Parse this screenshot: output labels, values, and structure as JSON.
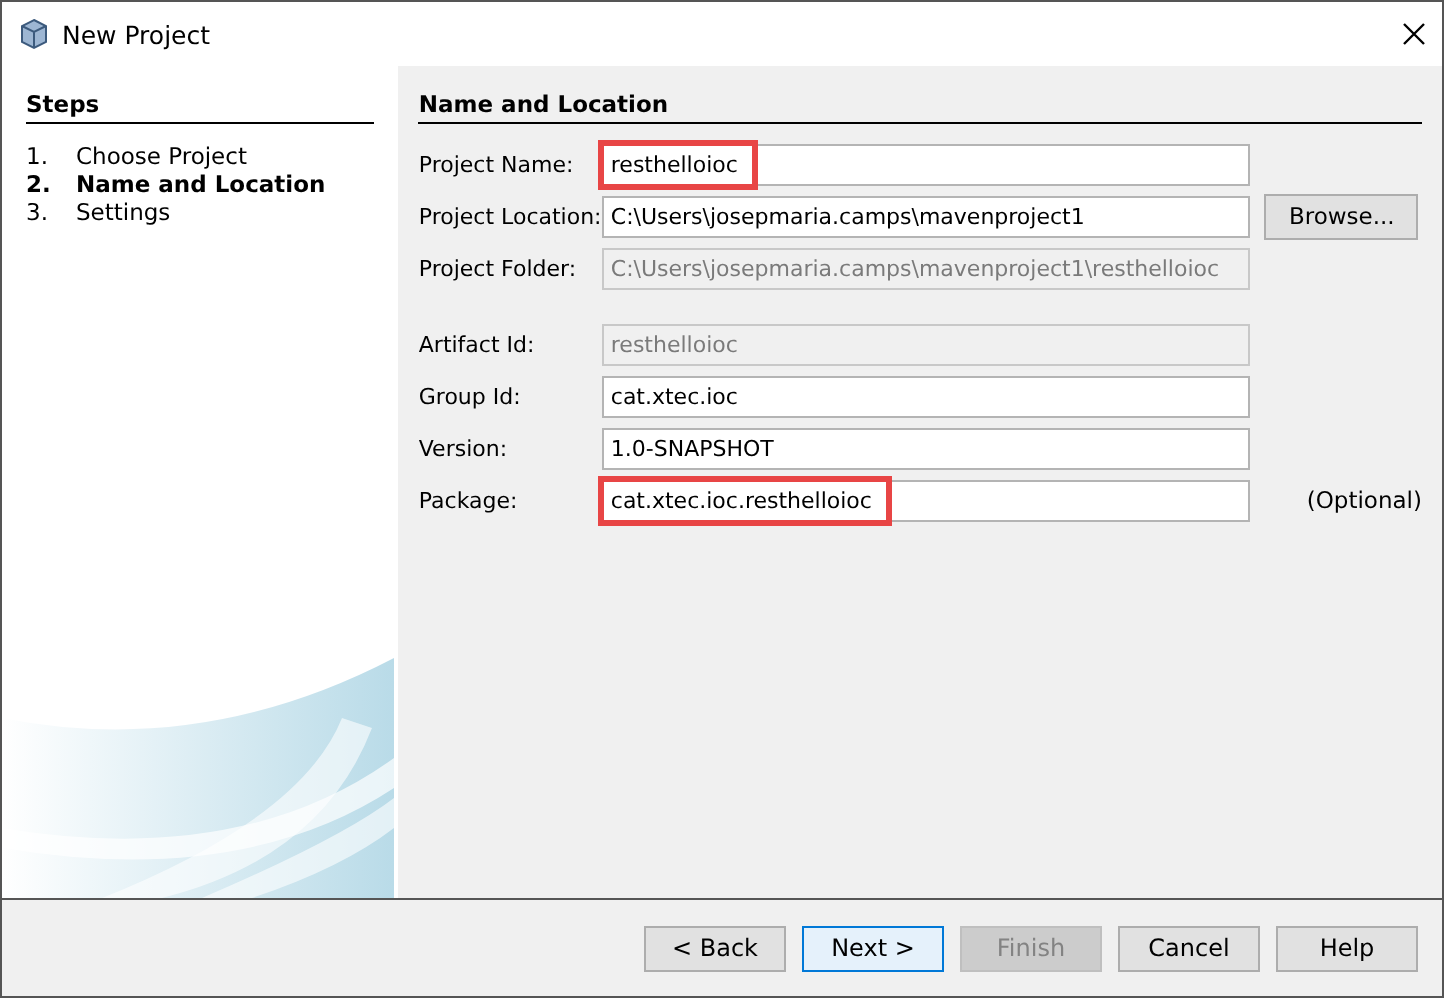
{
  "window": {
    "title": "New Project"
  },
  "steps": {
    "heading": "Steps",
    "items": [
      {
        "number": "1.",
        "label": "Choose Project",
        "selected": false
      },
      {
        "number": "2.",
        "label": "Name and Location",
        "selected": true
      },
      {
        "number": "3.",
        "label": "Settings",
        "selected": false
      }
    ]
  },
  "panel": {
    "heading": "Name and Location",
    "field_groups": [
      {
        "fields": [
          {
            "label": "Project Name:",
            "value": "resthelloioc",
            "disabled": false,
            "highlighted": true
          },
          {
            "label": "Project Location:",
            "value": "C:\\Users\\josepmaria.camps\\mavenproject1",
            "disabled": false,
            "highlighted": false,
            "button": "Browse..."
          },
          {
            "label": "Project Folder:",
            "value": "C:\\Users\\josepmaria.camps\\mavenproject1\\resthelloioc",
            "disabled": true,
            "highlighted": false
          }
        ]
      },
      {
        "fields": [
          {
            "label": "Artifact Id:",
            "value": "resthelloioc",
            "disabled": true,
            "highlighted": false
          },
          {
            "label": "Group Id:",
            "value": "cat.xtec.ioc",
            "disabled": false,
            "highlighted": false
          },
          {
            "label": "Version:",
            "value": "1.0-SNAPSHOT",
            "disabled": false,
            "highlighted": false
          },
          {
            "label": "Package:",
            "value": "cat.xtec.ioc.resthelloioc",
            "disabled": false,
            "highlighted": true,
            "note": "(Optional)"
          }
        ]
      }
    ]
  },
  "buttons": [
    {
      "label": "< Back",
      "disabled": false,
      "default": false
    },
    {
      "label": "Next >",
      "disabled": false,
      "default": true
    },
    {
      "label": "Finish",
      "disabled": true,
      "default": false
    },
    {
      "label": "Cancel",
      "disabled": false,
      "default": false
    },
    {
      "label": "Help",
      "disabled": false,
      "default": false
    }
  ]
}
